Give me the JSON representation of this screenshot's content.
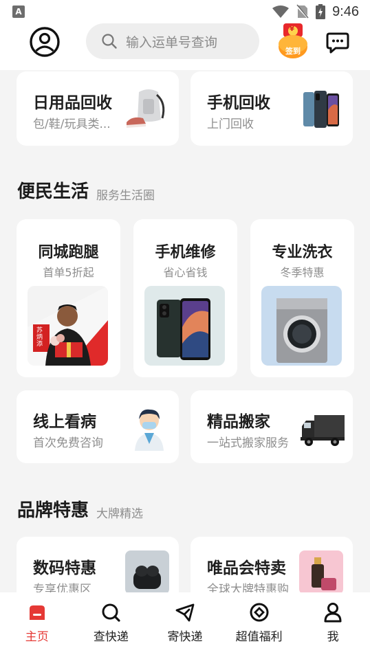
{
  "status_bar": {
    "time": "9:46",
    "left_icon": "A"
  },
  "header": {
    "search_placeholder": "输入运单号查询",
    "signin_label": "签到",
    "signin_coin": "¥"
  },
  "recycle": [
    {
      "title": "日用品回收",
      "subtitle": "包/鞋/玩具类..."
    },
    {
      "title": "手机回收",
      "subtitle": "上门回收"
    }
  ],
  "convenience": {
    "title": "便民生活",
    "subtitle": "服务生活圈",
    "services": [
      {
        "title": "同城跑腿",
        "subtitle": "首单5折起",
        "image_text": "苏炳添"
      },
      {
        "title": "手机维修",
        "subtitle": "省心省钱"
      },
      {
        "title": "专业洗衣",
        "subtitle": "冬季特惠"
      }
    ],
    "wide": [
      {
        "title": "线上看病",
        "subtitle": "首次免费咨询"
      },
      {
        "title": "精品搬家",
        "subtitle": "一站式搬家服务"
      }
    ]
  },
  "brand": {
    "title": "品牌特惠",
    "subtitle": "大牌精选",
    "cards": [
      {
        "title": "数码特惠",
        "subtitle": "专享优惠区"
      },
      {
        "title": "唯品会特卖",
        "subtitle": "全球大牌特惠购"
      }
    ]
  },
  "nav": [
    {
      "label": "主页",
      "icon": "home-icon",
      "active": true
    },
    {
      "label": "查快递",
      "icon": "search-icon",
      "active": false
    },
    {
      "label": "寄快递",
      "icon": "send-icon",
      "active": false
    },
    {
      "label": "超值福利",
      "icon": "target-icon",
      "active": false
    },
    {
      "label": "我",
      "icon": "user-icon",
      "active": false
    }
  ],
  "colors": {
    "accent": "#e53935",
    "background": "#f4f4f4",
    "card": "#ffffff"
  }
}
